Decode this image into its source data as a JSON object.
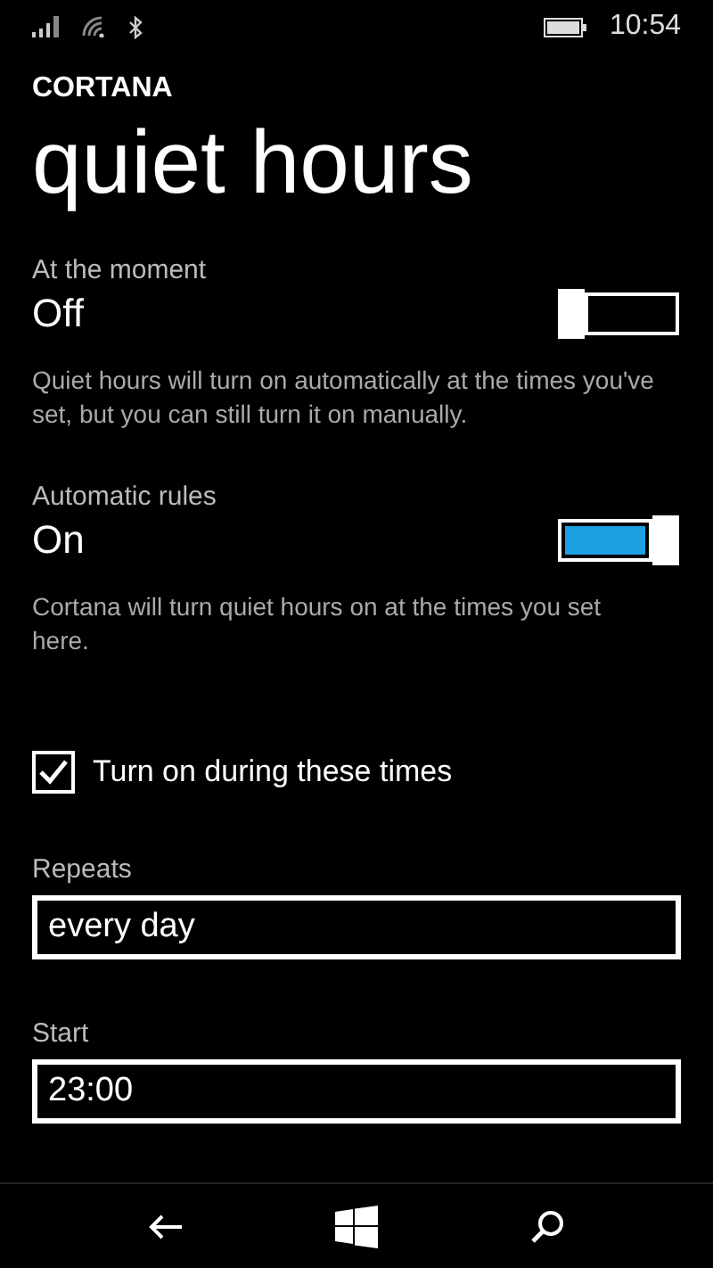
{
  "status_bar": {
    "time": "10:54"
  },
  "app_name": "CORTANA",
  "page_title": "quiet hours",
  "settings": [
    {
      "label": "At the moment",
      "value": "Off",
      "on": false,
      "description": "Quiet hours will turn on automatically at the times you've set, but you can still turn it on manually."
    },
    {
      "label": "Automatic rules",
      "value": "On",
      "on": true,
      "description": "Cortana will turn quiet hours on at the times you set here."
    }
  ],
  "checkbox": {
    "label": "Turn on during these times",
    "checked": true
  },
  "fields": [
    {
      "label": "Repeats",
      "value": "every day"
    },
    {
      "label": "Start",
      "value": "23:00"
    }
  ]
}
